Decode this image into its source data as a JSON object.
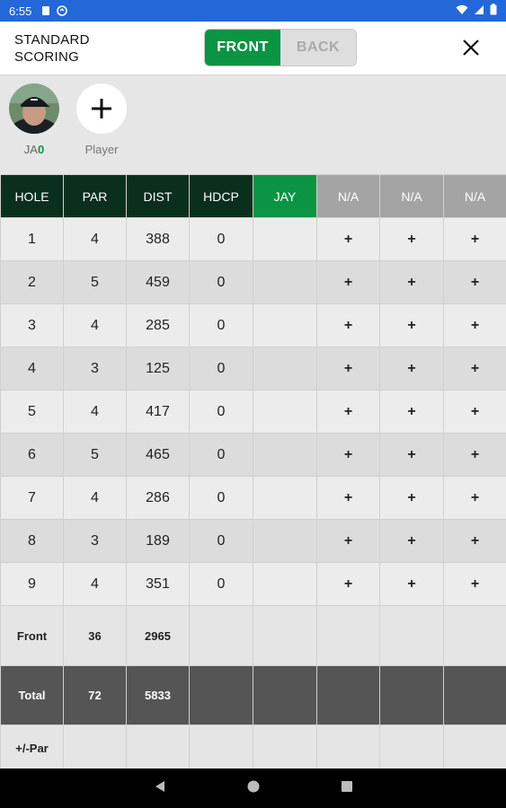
{
  "status_bar": {
    "time": "6:55"
  },
  "header": {
    "title": "STANDARD SCORING",
    "front_label": "FRONT",
    "back_label": "BACK"
  },
  "players": {
    "avatar_initials": "JA",
    "avatar_score": "0",
    "add_label": "Player"
  },
  "columns": [
    "HOLE",
    "PAR",
    "DIST",
    "HDCP",
    "JAY",
    "N/A",
    "N/A",
    "N/A"
  ],
  "holes": [
    {
      "hole": "1",
      "par": "4",
      "dist": "388",
      "hdcp": "0"
    },
    {
      "hole": "2",
      "par": "5",
      "dist": "459",
      "hdcp": "0"
    },
    {
      "hole": "3",
      "par": "4",
      "dist": "285",
      "hdcp": "0"
    },
    {
      "hole": "4",
      "par": "3",
      "dist": "125",
      "hdcp": "0"
    },
    {
      "hole": "5",
      "par": "4",
      "dist": "417",
      "hdcp": "0"
    },
    {
      "hole": "6",
      "par": "5",
      "dist": "465",
      "hdcp": "0"
    },
    {
      "hole": "7",
      "par": "4",
      "dist": "286",
      "hdcp": "0"
    },
    {
      "hole": "8",
      "par": "3",
      "dist": "189",
      "hdcp": "0"
    },
    {
      "hole": "9",
      "par": "4",
      "dist": "351",
      "hdcp": "0"
    }
  ],
  "plus_symbol": "+",
  "front_row": {
    "label": "Front",
    "par": "36",
    "dist": "2965"
  },
  "total_row": {
    "label": "Total",
    "par": "72",
    "dist": "5833"
  },
  "par_row": {
    "label": "+/-Par"
  },
  "colors": {
    "accent_green": "#0a9444",
    "header_dark": "#0b2f1d",
    "status_blue": "#2467d8"
  }
}
